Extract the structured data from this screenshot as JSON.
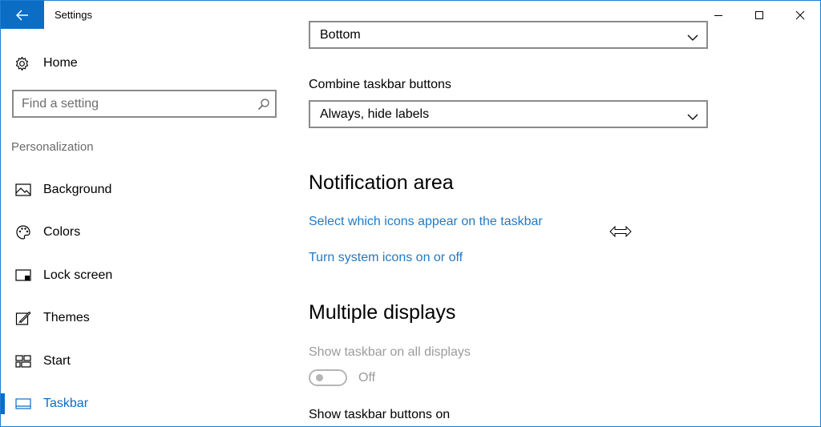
{
  "window": {
    "title": "Settings"
  },
  "sidebar": {
    "home_label": "Home",
    "search_placeholder": "Find a setting",
    "section_label": "Personalization",
    "items": [
      {
        "label": "Background",
        "icon": "picture-icon"
      },
      {
        "label": "Colors",
        "icon": "palette-icon"
      },
      {
        "label": "Lock screen",
        "icon": "lock-screen-icon"
      },
      {
        "label": "Themes",
        "icon": "themes-icon"
      },
      {
        "label": "Start",
        "icon": "start-icon"
      },
      {
        "label": "Taskbar",
        "icon": "taskbar-icon",
        "selected": true
      }
    ]
  },
  "content": {
    "taskbar_location_value": "Bottom",
    "combine_label": "Combine taskbar buttons",
    "combine_value": "Always, hide labels",
    "notification_heading": "Notification area",
    "link_select_icons": "Select which icons appear on the taskbar",
    "link_system_icons": "Turn system icons on or off",
    "multiple_heading": "Multiple displays",
    "show_all_displays_label": "Show taskbar on all displays",
    "show_all_displays_state": "Off",
    "show_buttons_on_label": "Show taskbar buttons on"
  },
  "colors": {
    "accent": "#0c6dc4",
    "link": "#1f7ac6",
    "disabled": "#9b9b9b"
  }
}
